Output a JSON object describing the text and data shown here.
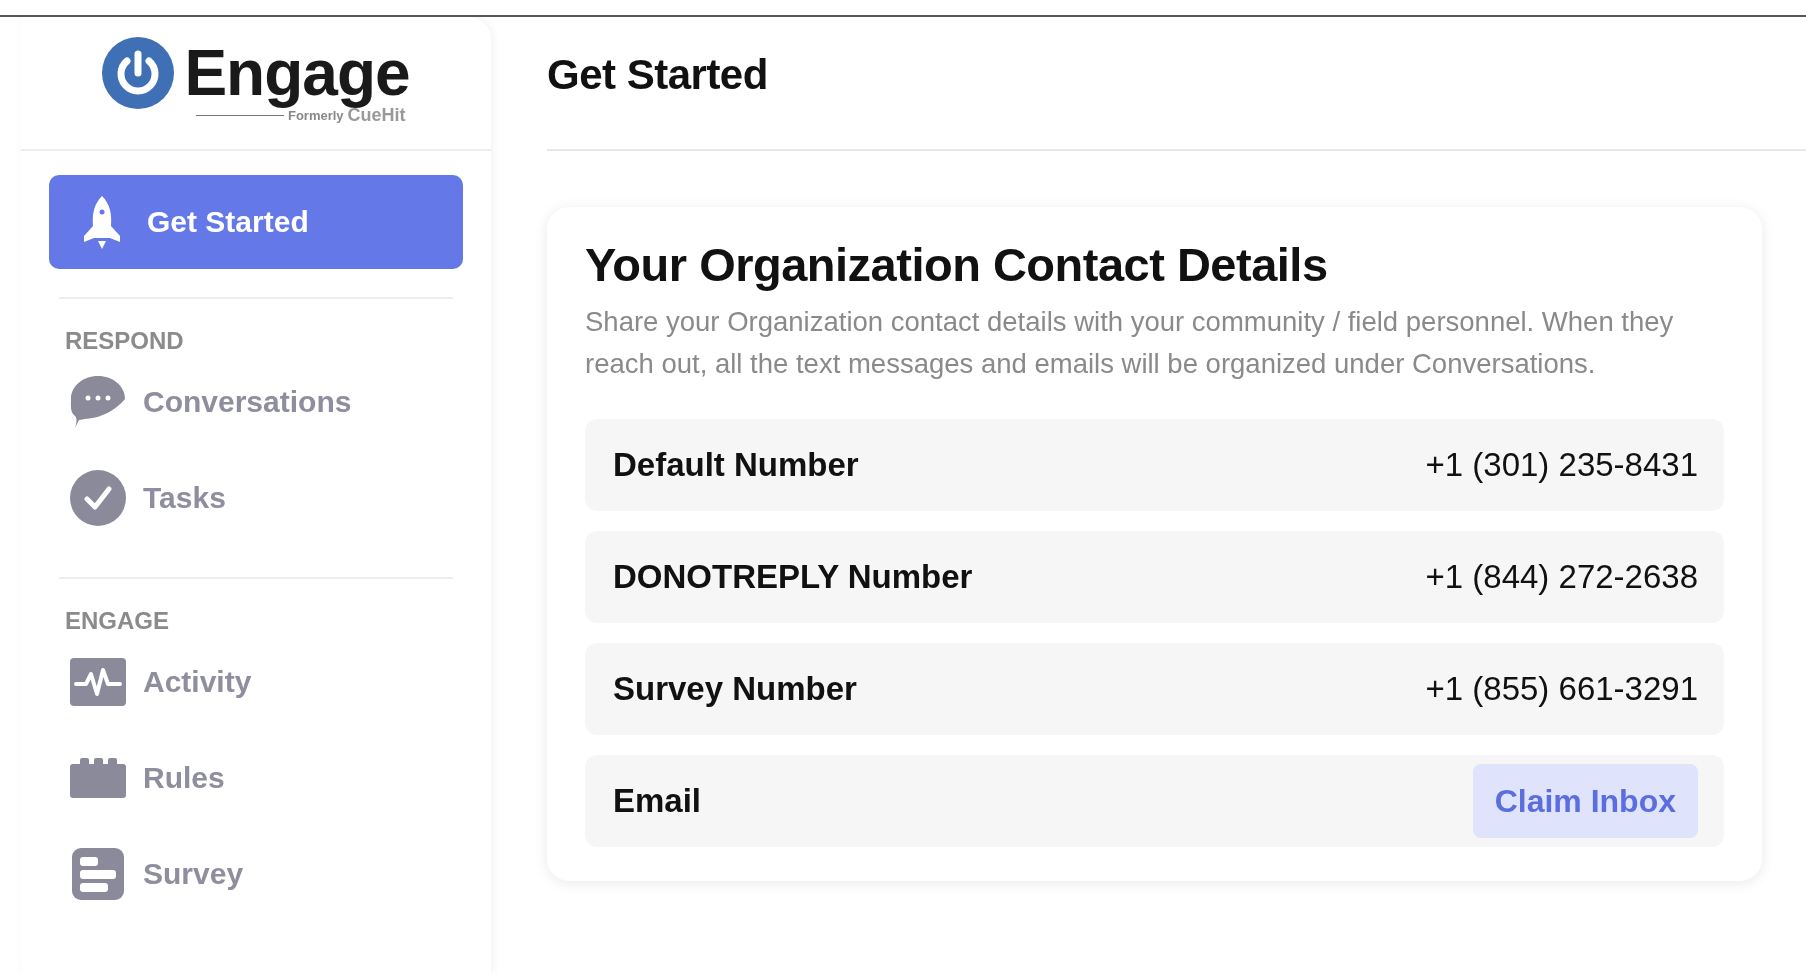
{
  "logo": {
    "name": "Engage",
    "prefix": "Formerly",
    "former_name": "CueHit"
  },
  "sidebar": {
    "items": [
      {
        "kind": "nav",
        "label": "Get Started",
        "selected": true
      }
    ],
    "sections": [
      {
        "heading": "RESPOND",
        "items": [
          {
            "label": "Conversations",
            "selected": false
          },
          {
            "label": "Tasks",
            "selected": false
          }
        ]
      },
      {
        "heading": "ENGAGE",
        "items": [
          {
            "label": "Activity",
            "selected": false
          },
          {
            "label": "Rules",
            "selected": false
          },
          {
            "label": "Survey",
            "selected": false
          }
        ]
      }
    ]
  },
  "page": {
    "title": "Get Started"
  },
  "card": {
    "title": "Your Organization Contact Details",
    "description": "Share your Organization contact details with your community / field personnel. When they reach out, all the text messages and emails will be organized under Conversations.",
    "rows": [
      {
        "kind": "value",
        "label": "Default Number",
        "value": "+1 (301) 235-8431"
      },
      {
        "kind": "value",
        "label": "DONOTREPLY Number",
        "value": "+1 (844) 272-2638"
      },
      {
        "kind": "value",
        "label": "Survey Number",
        "value": "+1 (855) 661-3291"
      },
      {
        "kind": "action",
        "label": "Email",
        "action": "Claim Inbox"
      }
    ]
  }
}
